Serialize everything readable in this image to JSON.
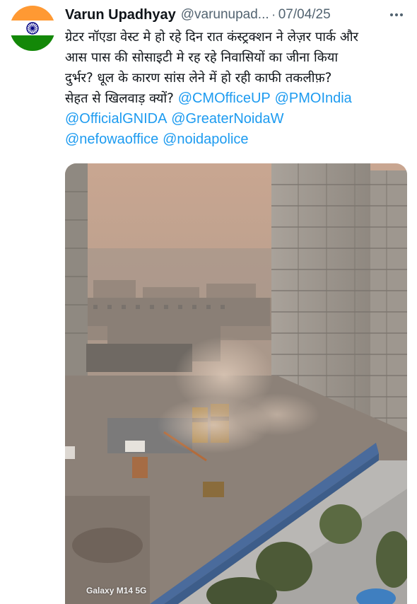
{
  "tweet": {
    "display_name": "Varun Upadhyay",
    "handle": "@varunupad...",
    "separator": "·",
    "date": "07/04/25",
    "text_lines": [
      "ग्रेटर नॉएडा वेस्ट मे हो रहे दिन रात कंस्ट्रक्शन ने लेज़र पार्क और",
      "आस पास की सोसाइटी मे रह रहे निवासियों का जीना किया",
      "दुर्भर? धूल के कारण सांस लेने में हो रही काफी तकलीफ़?",
      "सेहत से खिलवाड़ क्यों?"
    ],
    "mentions": [
      "@CMOfficeUP",
      "@PMOIndia",
      "@OfficialGNIDA",
      "@GreaterNoidaW",
      "@nefowaoffice",
      "@noidapolice"
    ],
    "media": {
      "watermark": "Galaxy M14 5G"
    }
  },
  "colors": {
    "text": "#0f1419",
    "secondary": "#536471",
    "link": "#1d9bf0",
    "flag_saffron": "#ff9933",
    "flag_green": "#138808",
    "flag_chakra": "#000080"
  },
  "icons": {
    "avatar": "india-flag-avatar",
    "more": "more-horizontal-icon"
  }
}
